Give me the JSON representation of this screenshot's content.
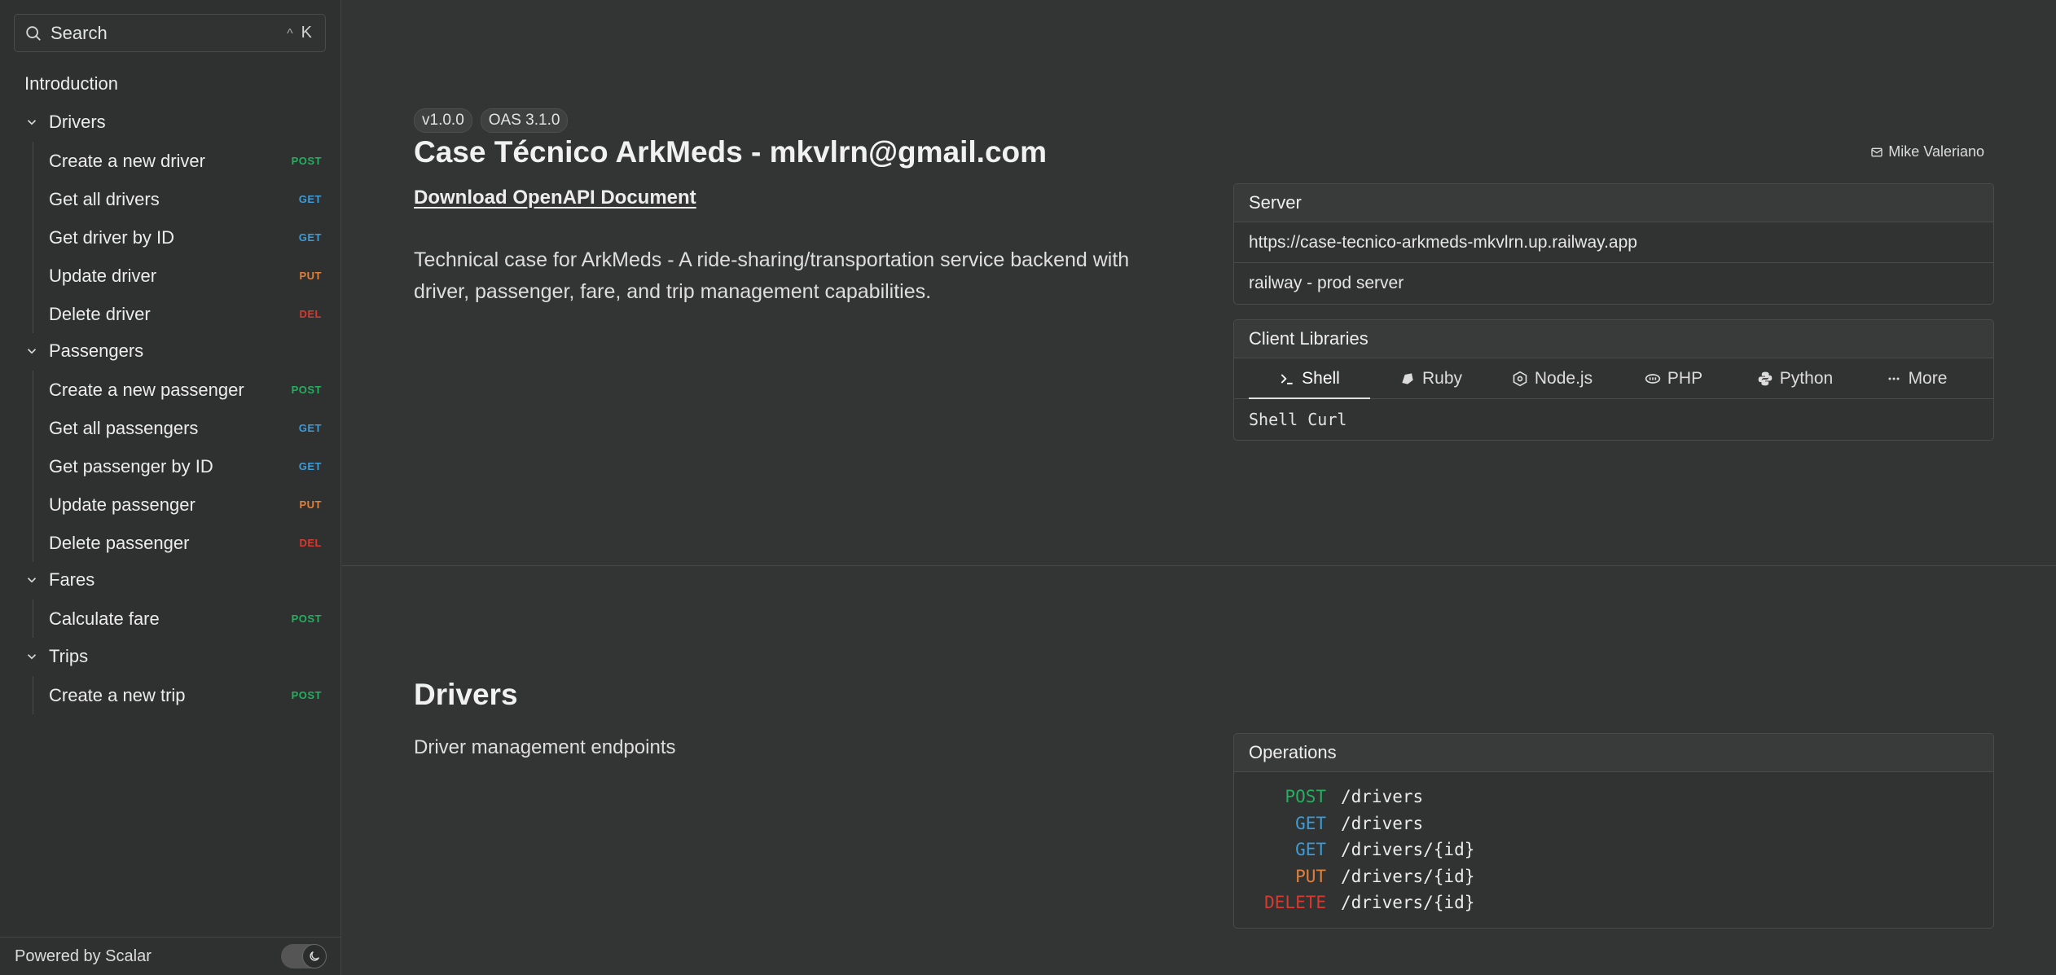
{
  "sidebar": {
    "search": {
      "label": "Search",
      "shortcut_mod": "^",
      "shortcut_key": "K"
    },
    "intro": "Introduction",
    "groups": [
      {
        "label": "Drivers",
        "items": [
          {
            "label": "Create a new driver",
            "method": "POST"
          },
          {
            "label": "Get all drivers",
            "method": "GET"
          },
          {
            "label": "Get driver by ID",
            "method": "GET"
          },
          {
            "label": "Update driver",
            "method": "PUT"
          },
          {
            "label": "Delete driver",
            "method": "DEL"
          }
        ]
      },
      {
        "label": "Passengers",
        "items": [
          {
            "label": "Create a new passenger",
            "method": "POST"
          },
          {
            "label": "Get all passengers",
            "method": "GET"
          },
          {
            "label": "Get passenger by ID",
            "method": "GET"
          },
          {
            "label": "Update passenger",
            "method": "PUT"
          },
          {
            "label": "Delete passenger",
            "method": "DEL"
          }
        ]
      },
      {
        "label": "Fares",
        "items": [
          {
            "label": "Calculate fare",
            "method": "POST"
          }
        ]
      },
      {
        "label": "Trips",
        "items": [
          {
            "label": "Create a new trip",
            "method": "POST"
          }
        ]
      }
    ],
    "footer": "Powered by Scalar"
  },
  "header": {
    "version": "v1.0.0",
    "oas": "OAS 3.1.0",
    "title": "Case Técnico ArkMeds - mkvlrn@gmail.com",
    "download": "Download OpenAPI Document",
    "description": "Technical case for ArkMeds - A ride-sharing/transportation service backend with driver, passenger, fare, and trip management capabilities.",
    "contact": "Mike Valeriano"
  },
  "server": {
    "title": "Server",
    "url": "https://case-tecnico-arkmeds-mkvlrn.up.railway.app",
    "description": "railway - prod server"
  },
  "client_libraries": {
    "title": "Client Libraries",
    "tabs": [
      {
        "label": "Shell",
        "icon": "terminal-icon"
      },
      {
        "label": "Ruby",
        "icon": "ruby-icon"
      },
      {
        "label": "Node.js",
        "icon": "nodejs-icon"
      },
      {
        "label": "PHP",
        "icon": "php-icon"
      },
      {
        "label": "Python",
        "icon": "python-icon"
      },
      {
        "label": "More",
        "icon": "more-icon"
      }
    ],
    "active": "Shell",
    "selected": "Shell Curl"
  },
  "drivers_section": {
    "title": "Drivers",
    "description": "Driver management endpoints",
    "operations_title": "Operations",
    "operations": [
      {
        "method": "POST",
        "path": "/drivers"
      },
      {
        "method": "GET",
        "path": "/drivers"
      },
      {
        "method": "GET",
        "path": "/drivers/{id}"
      },
      {
        "method": "PUT",
        "path": "/drivers/{id}"
      },
      {
        "method": "DELETE",
        "path": "/drivers/{id}"
      }
    ]
  },
  "colors": {
    "background": "#333434",
    "sidebar": "#2f3030",
    "post": "#27ae60",
    "get": "#3d9bd8",
    "put": "#e0803a",
    "delete": "#d93a2f"
  }
}
